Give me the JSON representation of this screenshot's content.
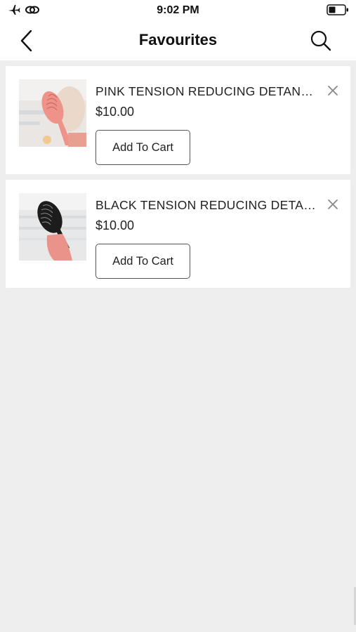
{
  "status_bar": {
    "time": "9:02 PM",
    "icons": [
      "airplane-icon",
      "link-icon",
      "battery-icon"
    ]
  },
  "nav": {
    "title": "Favourites",
    "back_icon": "chevron-left-icon",
    "search_icon": "search-icon"
  },
  "favourites": [
    {
      "name": "PINK TENSION REDUCING DETANGLING BRUSH",
      "price": "$10.00",
      "button_label": "Add To Cart",
      "image": "pink-brush-photo",
      "brush_color": "#ee8f8a"
    },
    {
      "name": "BLACK TENSION REDUCING DETANGLING BRUSH",
      "price": "$10.00",
      "button_label": "Add To Cart",
      "image": "black-brush-photo",
      "brush_color": "#1c1c1c"
    }
  ]
}
